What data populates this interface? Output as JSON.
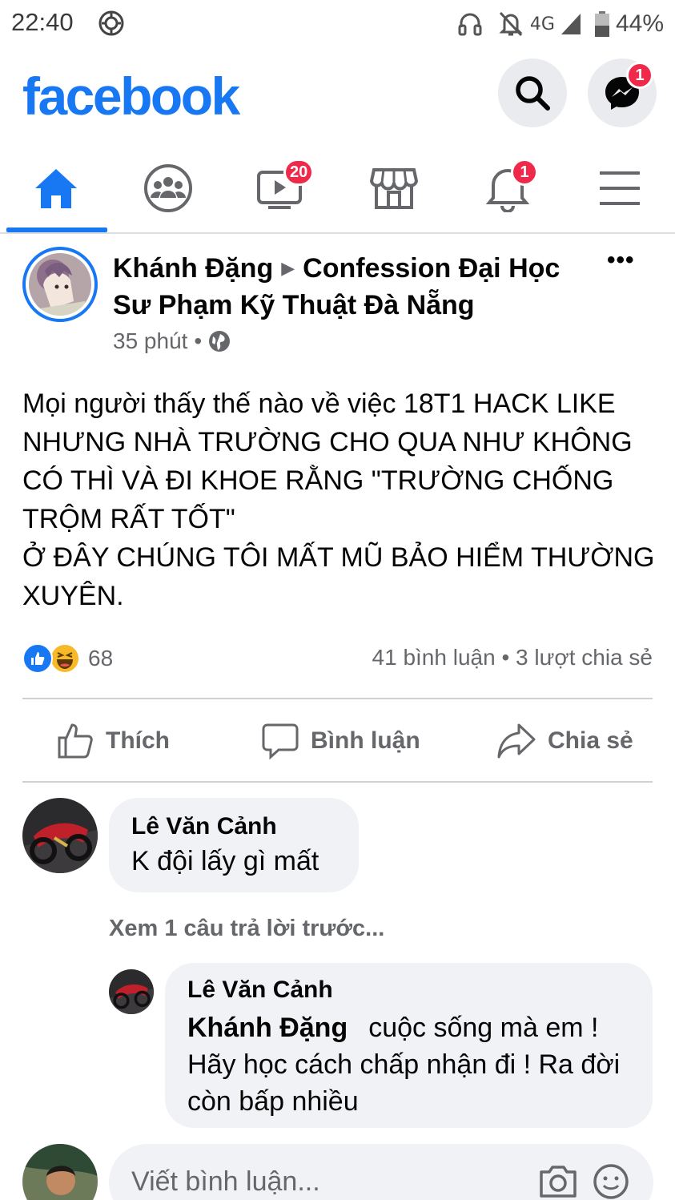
{
  "status_bar": {
    "time": "22:40",
    "network": "4G",
    "battery": "44%",
    "icons": [
      "sync-icon",
      "headphones-icon",
      "notifications-off-icon",
      "signal-icon",
      "battery-icon"
    ]
  },
  "header": {
    "brand": "facebook",
    "brand_color": "#1877f2",
    "messenger_badge": "1"
  },
  "tabs": [
    {
      "name": "home",
      "icon": "home-icon",
      "active": true,
      "badge": ""
    },
    {
      "name": "groups",
      "icon": "groups-icon",
      "active": false,
      "badge": ""
    },
    {
      "name": "watch",
      "icon": "video-icon",
      "active": false,
      "badge": "20"
    },
    {
      "name": "marketplace",
      "icon": "store-icon",
      "active": false,
      "badge": ""
    },
    {
      "name": "notifications",
      "icon": "bell-icon",
      "active": false,
      "badge": "1"
    },
    {
      "name": "menu",
      "icon": "menu-icon",
      "active": false,
      "badge": ""
    }
  ],
  "post": {
    "author": "Khánh Đặng",
    "group": "Confession Đại Học Sư Phạm Kỹ Thuật Đà Nẵng",
    "time": "35 phút",
    "privacy_icon": "globe-icon",
    "body": "Mọi người thấy thế nào về việc 18T1 HACK LIKE NHƯNG NHÀ TRƯỜNG CHO QUA NHƯ KHÔNG CÓ THÌ VÀ ĐI KHOE RẰNG \"TRƯỜNG CHỐNG TRỘM RẤT TỐT\"\nỞ ĐÂY CHÚNG TÔI MẤT MŨ BẢO HIỂM THƯỜNG XUYÊN.",
    "reaction_count": "68",
    "comments_count": "41 bình luận",
    "shares_count": "3 lượt chia sẻ",
    "stats_separator": "•"
  },
  "actions": {
    "like": "Thích",
    "comment": "Bình luận",
    "share": "Chia sẻ"
  },
  "comments": [
    {
      "author": "Lê Văn Cảnh",
      "text": "K đội lấy gì mất"
    }
  ],
  "view_previous_replies": "Xem 1 câu trả lời trước...",
  "reply": {
    "author": "Lê Văn Cảnh",
    "mention": "Khánh Đặng",
    "text": "cuộc sống mà em ! Hãy học cách chấp nhận đi ! Ra đời còn bấp nhiều"
  },
  "composer": {
    "placeholder": "Viết bình luận..."
  }
}
